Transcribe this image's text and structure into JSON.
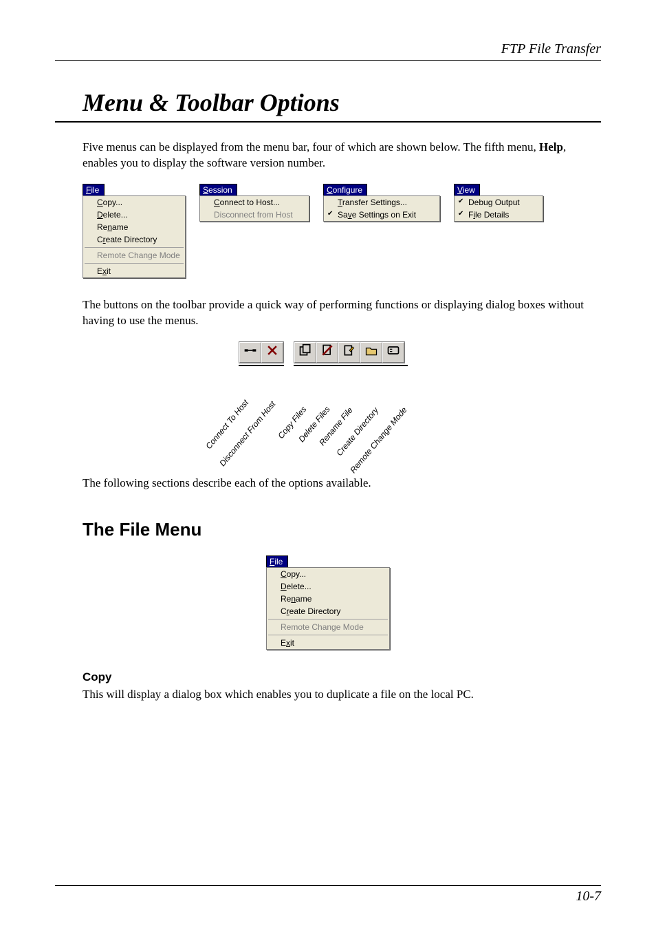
{
  "header": {
    "right": "FTP File Transfer"
  },
  "title": "Menu & Toolbar Options",
  "intro": {
    "line1": "Five menus can be displayed from the menu bar, four of which are shown below. The fifth menu, ",
    "bold": "Help",
    "line2": ", enables you to display the software version number."
  },
  "menus": {
    "file": {
      "title_pre": "F",
      "title_u": "",
      "title": "ile",
      "items": [
        "Copy...",
        "Delete...",
        "Rename",
        "Create Directory"
      ],
      "disabled": [
        "Remote Change Mode"
      ],
      "last": [
        "Exit"
      ]
    },
    "session": {
      "title_pre": "",
      "title_u": "S",
      "title": "ession",
      "items": [
        "Connect to Host..."
      ],
      "disabled": [
        "Disconnect from Host"
      ]
    },
    "configure": {
      "title_pre": "",
      "title_u": "C",
      "title": "onfigure",
      "items": [
        "Transfer Settings...",
        "Save Settings on Exit"
      ]
    },
    "view": {
      "title_pre": "",
      "title_u": "V",
      "title": "iew",
      "items": [
        "Debug Output",
        "File Details"
      ]
    }
  },
  "para_toolbar": "The buttons on the toolbar provide a quick way of performing functions or displaying dialog boxes without having to use the menus.",
  "toolbar_labels": [
    "Connect To Host",
    "Disconnect From Host",
    "Copy Files",
    "Delete Files",
    "Rename File",
    "Create Directory",
    "Remote Change Mode"
  ],
  "para_following": "The following sections describe each of the options available.",
  "section": "The File Menu",
  "file_menu2": {
    "title_pre": "F",
    "title": "ile",
    "items": [
      "Copy...",
      "Delete...",
      "Rename",
      "Create Directory"
    ],
    "disabled": [
      "Remote Change Mode"
    ],
    "last": [
      "Exit"
    ]
  },
  "copy": {
    "heading": "Copy",
    "text": "This will display a dialog box which enables you to duplicate a file on the local PC."
  },
  "footer": "10-7"
}
